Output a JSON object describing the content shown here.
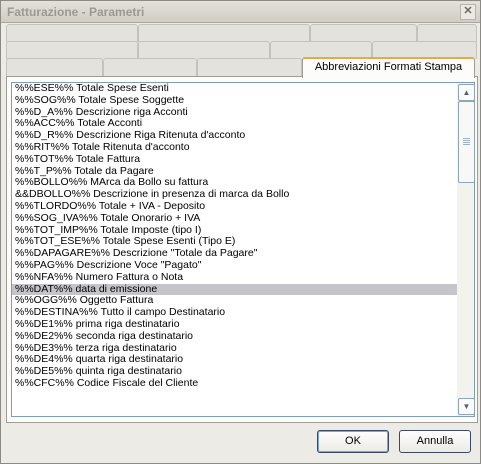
{
  "window": {
    "title": "Fatturazione - Parametri"
  },
  "tabs": {
    "row1": [
      "",
      "",
      "",
      ""
    ],
    "row2": [
      "",
      "",
      "",
      ""
    ],
    "row3": [
      "",
      "",
      "",
      "Abbreviazioni Formati Stampa"
    ]
  },
  "list": {
    "selected_index": 20,
    "items": [
      "%%ESE%% Totale Spese Esenti",
      "%%SOG%% Totale Spese Soggette",
      "%%D_A%% Descrizione riga Acconti",
      "%%ACC%% Totale Acconti",
      "%%D_R%% Descrizione Riga Ritenuta d'acconto",
      "%%RIT%% Totale Ritenuta d'acconto",
      "%%TOT%% Totale Fattura",
      "%%T_P%% Totale da Pagare",
      "%%BOLLO%% MArca da Bollo su fattura",
      "&&DBOLLO%% Descrizione in presenza di marca da Bollo",
      "%%TLORDO%% Totale + IVA - Deposito",
      "%%SOG_IVA%% Totale Onorario + IVA",
      "%%TOT_IMP%% Totale Imposte (tipo I)",
      "%%TOT_ESE%% Totale Spese Esenti (Tipo E)",
      "%%DAPAGARE%% Descrizione \"Totale da Pagare\"",
      "%%PAG%% Descrizione Voce \"Pagato\"",
      "%%NFA%% Numero Fattura o Nota",
      "%%DAT%% data di emissione",
      "%%OGG%% Oggetto Fattura",
      "%%DESTINA%% Tutto il campo Destinatario",
      "%%DE1%% prima riga destinatario",
      "%%DE2%% seconda riga destinatario",
      "%%DE3%% terza riga destinatario",
      "%%DE4%% quarta riga destinatario",
      "%%DE5%% quinta riga destinatario",
      "%%CFC%% Codice Fiscale del Cliente"
    ]
  },
  "buttons": {
    "ok": "OK",
    "cancel": "Annulla"
  },
  "icons": {
    "close": "close-icon",
    "scroll_up": "scroll-up-arrow-icon",
    "scroll_down": "scroll-down-arrow-icon"
  }
}
